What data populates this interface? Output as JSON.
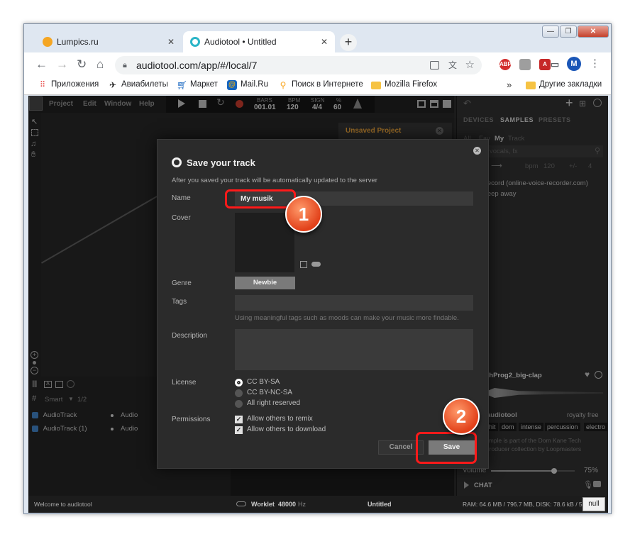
{
  "browser": {
    "tabs": [
      {
        "title": "Lumpics.ru",
        "favicon_color": "#f5a623"
      },
      {
        "title": "Audiotool • Untitled",
        "favicon_color": "#2bb5c7"
      }
    ],
    "new_tab": "+",
    "url": "audiotool.com/app/#/local/7",
    "profile_initial": "M",
    "ext_abp": "ABP",
    "bookmarks": [
      {
        "label": "Приложения",
        "icon": "apps-grid-icon"
      },
      {
        "label": "Авиабилеты",
        "icon": "plane-icon"
      },
      {
        "label": "Маркет",
        "icon": "cart-icon"
      },
      {
        "label": "Mail.Ru",
        "icon": "mail-icon"
      },
      {
        "label": "Поиск в Интернете",
        "icon": "search-bulb-icon"
      },
      {
        "label": "Mozilla Firefox",
        "icon": "folder-icon"
      }
    ],
    "bookmarks_more": "»",
    "other_bookmarks": "Другие закладки"
  },
  "app": {
    "menu": [
      "Project",
      "Edit",
      "Window",
      "Help"
    ],
    "transport": {
      "bars_label": "BARS",
      "bars_value": "001.01",
      "bpm_label": "BPM",
      "bpm_value": "120",
      "sign_label": "SIGN",
      "sign_value": "4/4",
      "percent_label": "%",
      "percent_value": "60"
    },
    "unsaved_project": "Unsaved Project",
    "right_tabs": [
      "DEVICES",
      "SAMPLES",
      "PRESETS"
    ],
    "filters": [
      "All",
      "Fav",
      "My",
      "Track"
    ],
    "search_placeholder": "vocals, fx",
    "bpm_label": "bpm",
    "bpm_value": "120",
    "pm_label": "+/-",
    "pm_value": "4",
    "list_items": [
      "Record (online-voice-recorder.com)",
      "sleep away"
    ],
    "sample_name": "chProg2_big-clap",
    "sample_source": "audiotool",
    "royalty": "royalty free",
    "tags": [
      "hit",
      "dom",
      "intense",
      "percussion",
      "electro"
    ],
    "sample_desc_1": "ample is part of the Dom Kane Tech",
    "sample_desc_2": "Producer collection by Loopmasters",
    "volume_label": "Volume",
    "volume_value": "75%",
    "volume_level": 0.75,
    "chat": "CHAT",
    "smart_label": "Smart",
    "smart_page": "1/2",
    "tracks": [
      {
        "name": "AudioTrack",
        "type": "Audio"
      },
      {
        "name": "AudioTrack (1)",
        "type": "Audio"
      }
    ],
    "status_welcome": "Welcome to audiotool",
    "worklet_label": "Worklet",
    "worklet_value": "48000",
    "worklet_unit": "Hz",
    "untitled": "Untitled",
    "ram": "RAM: 64.6 MB / 796.7 MB, DISK: 78.6 kB / 5",
    "null_badge": "null"
  },
  "dialog": {
    "title": "Save your track",
    "subtitle": "After you saved your track will be automatically updated to the server",
    "name_label": "Name",
    "name_value": "My musik",
    "cover_label": "Cover",
    "genre_label": "Genre",
    "genre_value": "Newbie",
    "tags_label": "Tags",
    "tags_hint": "Using meaningful tags such as moods can make your music more findable.",
    "description_label": "Description",
    "license_label": "License",
    "licenses": [
      "CC BY-SA",
      "CC BY-NC-SA",
      "All right reserved"
    ],
    "license_selected": 0,
    "permissions_label": "Permissions",
    "permissions": [
      "Allow others to remix",
      "Allow others to download"
    ],
    "cancel": "Cancel",
    "save": "Save"
  },
  "annotations": {
    "step1": "1",
    "step2": "2"
  },
  "colors": {
    "accent_orange": "#e8a23a",
    "highlight_red": "#ff1a1a",
    "badge_orange": "#e2411a"
  }
}
